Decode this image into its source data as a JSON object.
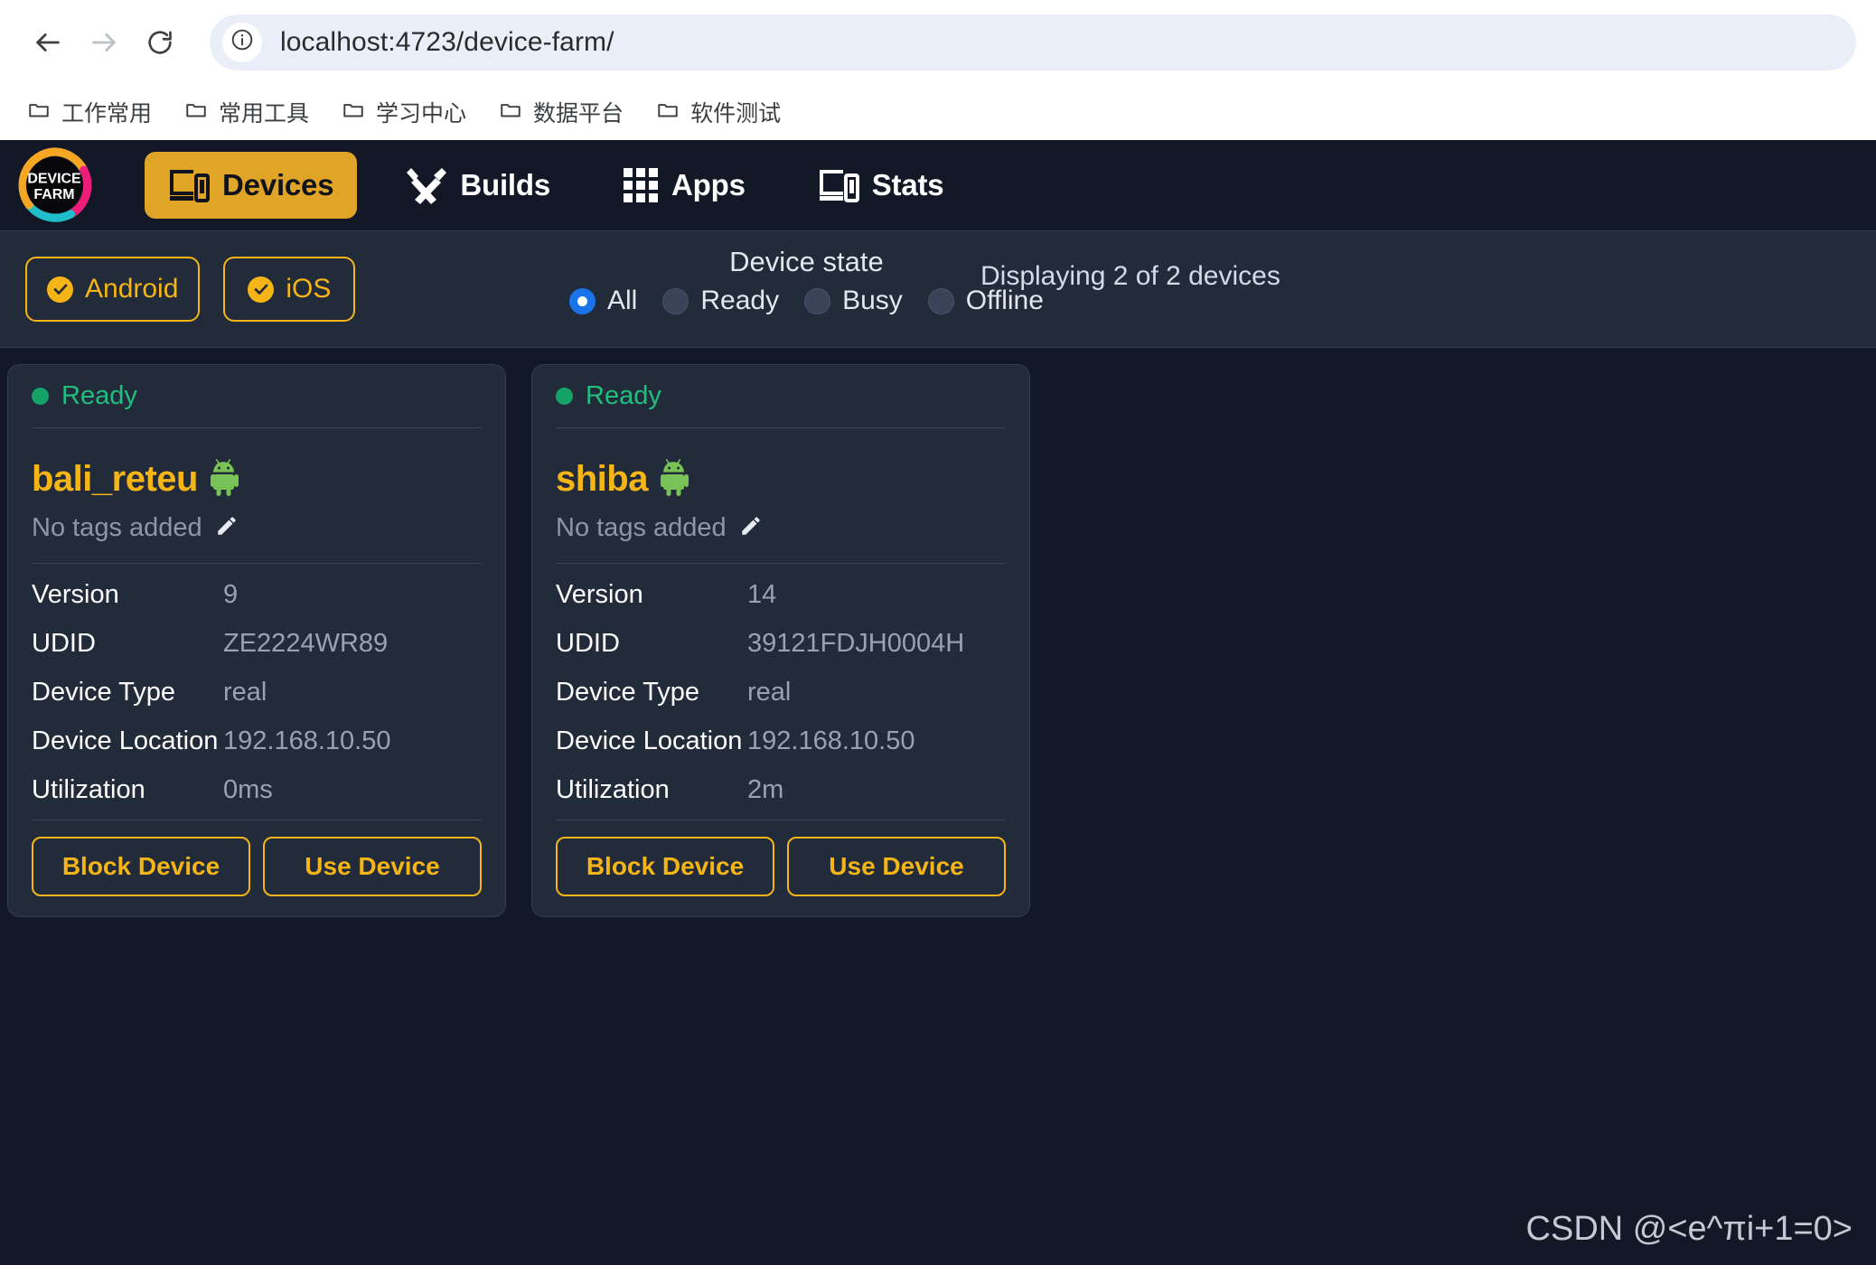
{
  "browser": {
    "back_icon": "back-arrow-icon",
    "forward_icon": "forward-arrow-icon",
    "reload_icon": "reload-icon",
    "info_icon": "info-icon",
    "url": "localhost:4723/device-farm/",
    "bookmarks": [
      {
        "label": "工作常用",
        "icon": "folder-icon"
      },
      {
        "label": "常用工具",
        "icon": "folder-icon"
      },
      {
        "label": "学习中心",
        "icon": "folder-icon"
      },
      {
        "label": "数据平台",
        "icon": "folder-icon"
      },
      {
        "label": "软件测试",
        "icon": "folder-icon"
      }
    ]
  },
  "app": {
    "logo": {
      "line1": "DEVICE",
      "line2": "FARM"
    },
    "nav": [
      {
        "label": "Devices",
        "icon": "devices-icon",
        "active": true
      },
      {
        "label": "Builds",
        "icon": "tools-icon",
        "active": false
      },
      {
        "label": "Apps",
        "icon": "grid-icon",
        "active": false
      },
      {
        "label": "Stats",
        "icon": "devices-icon",
        "active": false
      }
    ]
  },
  "filters": {
    "platforms": [
      {
        "label": "Android",
        "icon": "check-circle-icon",
        "selected": true
      },
      {
        "label": "iOS",
        "icon": "check-circle-icon",
        "selected": true
      }
    ],
    "device_state": {
      "title": "Device state",
      "options": [
        {
          "label": "All",
          "checked": true
        },
        {
          "label": "Ready",
          "checked": false
        },
        {
          "label": "Busy",
          "checked": false
        },
        {
          "label": "Offline",
          "checked": false
        }
      ]
    },
    "display_count": "Displaying 2 of 2 devices"
  },
  "devices": [
    {
      "status": "Ready",
      "name": "bali_reteu",
      "platform_icon": "android-robot-icon",
      "tags": "No tags added",
      "edit_icon": "pencil-icon",
      "specs": [
        {
          "label": "Version",
          "value": "9"
        },
        {
          "label": "UDID",
          "value": "ZE2224WR89"
        },
        {
          "label": "Device Type",
          "value": "real"
        },
        {
          "label": "Device Location",
          "value": "192.168.10.50"
        },
        {
          "label": "Utilization",
          "value": "0ms"
        }
      ],
      "actions": [
        {
          "label": "Block Device"
        },
        {
          "label": "Use Device"
        }
      ]
    },
    {
      "status": "Ready",
      "name": "shiba",
      "platform_icon": "android-robot-icon",
      "tags": "No tags added",
      "edit_icon": "pencil-icon",
      "specs": [
        {
          "label": "Version",
          "value": "14"
        },
        {
          "label": "UDID",
          "value": "39121FDJH0004H"
        },
        {
          "label": "Device Type",
          "value": "real"
        },
        {
          "label": "Device Location",
          "value": "192.168.10.50"
        },
        {
          "label": "Utilization",
          "value": "2m"
        }
      ],
      "actions": [
        {
          "label": "Block Device"
        },
        {
          "label": "Use Device"
        }
      ]
    }
  ],
  "watermark": "CSDN @<e^πi+1=0>",
  "colors": {
    "accent": "#f5b516",
    "nav_active_bg": "#e0a526",
    "page_bg": "#121826",
    "card_bg": "#222b3a",
    "ready_green": "#1fbf7d",
    "radio_blue": "#1a73e8",
    "android_green": "#78c257"
  }
}
